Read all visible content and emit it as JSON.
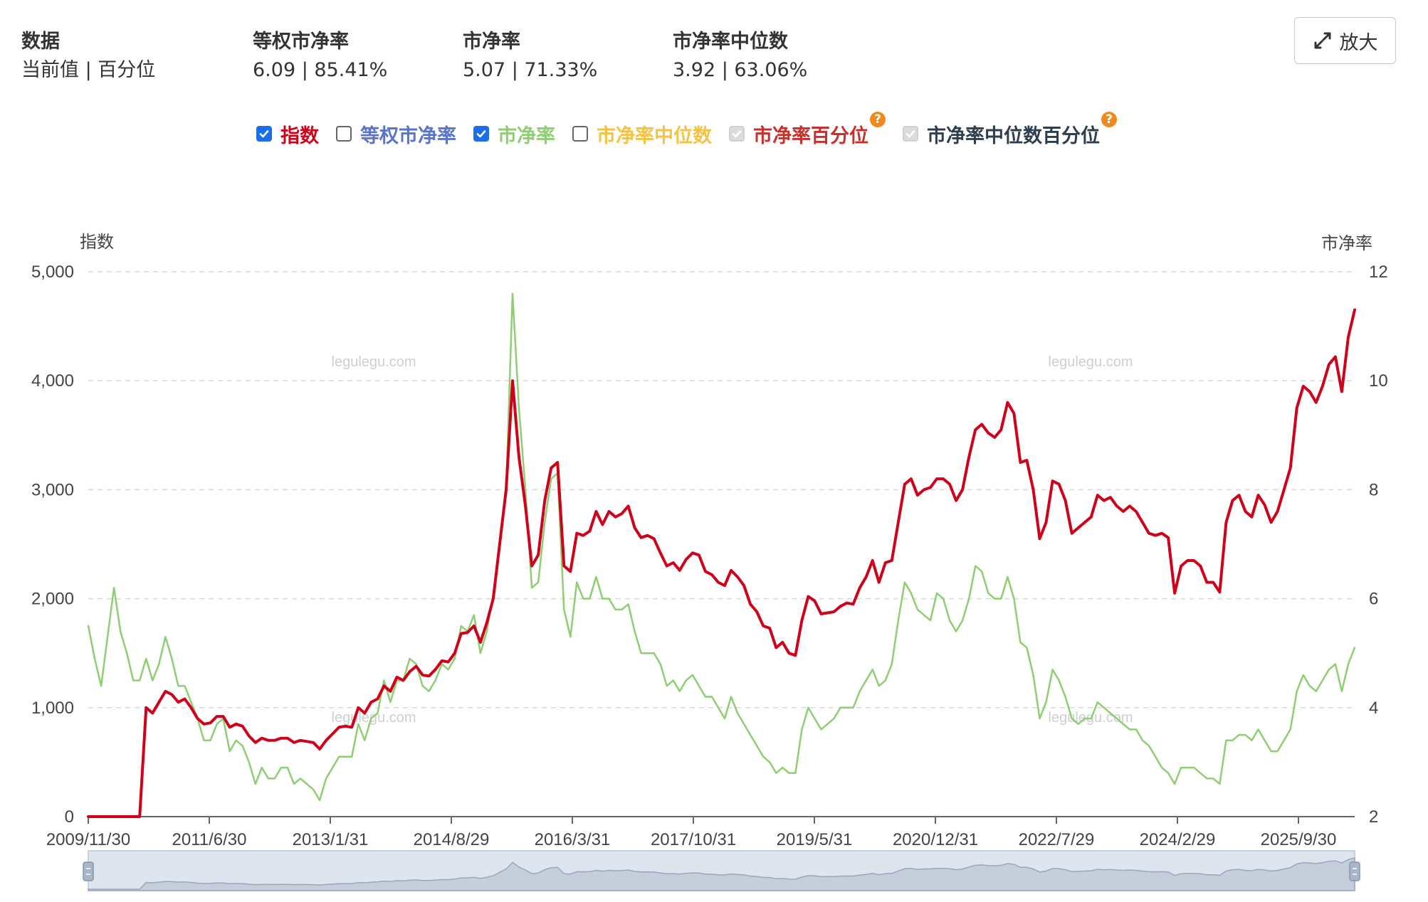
{
  "stats": [
    {
      "label": "数据",
      "value": "当前值 | 百分位"
    },
    {
      "label": "等权市净率",
      "value": "6.09 | 85.41%"
    },
    {
      "label": "市净率",
      "value": "5.07 | 71.33%"
    },
    {
      "label": "市净率中位数",
      "value": "3.92 | 63.06%"
    }
  ],
  "zoom_button": {
    "label": "放大",
    "icon": "expand-arrows-icon"
  },
  "legend": [
    {
      "label": "指数",
      "state": "checked",
      "color": "#d0021b"
    },
    {
      "label": "等权市净率",
      "state": "unchecked",
      "color": "#5b73c8"
    },
    {
      "label": "市净率",
      "state": "checked",
      "color": "#8fce72"
    },
    {
      "label": "市净率中位数",
      "state": "unchecked",
      "color": "#f5c242"
    },
    {
      "label": "市净率百分位",
      "state": "disabled",
      "color": "#c9302c",
      "help": "?"
    },
    {
      "label": "市净率中位数百分位",
      "state": "disabled",
      "color": "#2f3e4e",
      "help": "?"
    }
  ],
  "watermark": "legulegu.com",
  "chart_data": {
    "type": "line",
    "x_ticks": [
      "2009/11/30",
      "2011/6/30",
      "2013/1/31",
      "2014/8/29",
      "2016/3/31",
      "2017/10/31",
      "2019/5/31",
      "2020/12/31",
      "2022/7/29",
      "2024/2/29",
      "2025/9/30"
    ],
    "y_left": {
      "label": "指数",
      "range": [
        0,
        5000
      ],
      "ticks": [
        "0",
        "1,000",
        "2,000",
        "3,000",
        "4,000",
        "5,000"
      ]
    },
    "y_right": {
      "label": "市净率",
      "range": [
        2,
        12
      ],
      "ticks": [
        "2",
        "4",
        "6",
        "8",
        "10",
        "12"
      ]
    },
    "grid": "dashed horizontal",
    "series": [
      {
        "name": "指数",
        "axis": "left",
        "color": "#d0021b",
        "values": [
          0,
          0,
          0,
          0,
          0,
          0,
          0,
          0,
          0,
          1000,
          950,
          1050,
          1150,
          1120,
          1050,
          1080,
          1000,
          900,
          850,
          860,
          920,
          920,
          820,
          850,
          830,
          740,
          680,
          720,
          700,
          700,
          720,
          720,
          680,
          700,
          690,
          680,
          620,
          700,
          760,
          820,
          830,
          820,
          1000,
          950,
          1050,
          1080,
          1200,
          1150,
          1280,
          1250,
          1330,
          1380,
          1300,
          1290,
          1350,
          1430,
          1420,
          1500,
          1680,
          1690,
          1750,
          1600,
          1780,
          2000,
          2500,
          3000,
          4000,
          3300,
          2850,
          2300,
          2400,
          2900,
          3200,
          3250,
          2300,
          2250,
          2600,
          2580,
          2620,
          2800,
          2680,
          2800,
          2750,
          2780,
          2850,
          2650,
          2560,
          2580,
          2550,
          2420,
          2300,
          2330,
          2260,
          2360,
          2420,
          2400,
          2250,
          2220,
          2150,
          2120,
          2260,
          2200,
          2120,
          1950,
          1880,
          1750,
          1730,
          1550,
          1600,
          1500,
          1480,
          1800,
          2020,
          1980,
          1860,
          1870,
          1880,
          1930,
          1960,
          1950,
          2100,
          2200,
          2350,
          2150,
          2330,
          2350,
          2700,
          3050,
          3100,
          2950,
          3000,
          3020,
          3100,
          3100,
          3050,
          2900,
          3000,
          3300,
          3550,
          3600,
          3520,
          3480,
          3550,
          3800,
          3700,
          3250,
          3270,
          3000,
          2550,
          2700,
          3080,
          3050,
          2900,
          2600,
          2650,
          2700,
          2750,
          2950,
          2900,
          2930,
          2850,
          2800,
          2850,
          2800,
          2700,
          2600,
          2580,
          2600,
          2560,
          2050,
          2300,
          2350,
          2350,
          2300,
          2150,
          2150,
          2060,
          2700,
          2900,
          2950,
          2800,
          2750,
          2950,
          2860,
          2700,
          2800,
          3000,
          3200,
          3750,
          3950,
          3900,
          3800,
          3950,
          4150,
          4220,
          3900,
          4400,
          4650
        ]
      },
      {
        "name": "市净率",
        "axis": "right",
        "color": "#8fce72",
        "values": [
          5.5,
          4.9,
          4.4,
          5.3,
          6.2,
          5.4,
          5.0,
          4.5,
          4.5,
          4.9,
          4.5,
          4.8,
          5.3,
          4.9,
          4.4,
          4.4,
          4.1,
          3.8,
          3.4,
          3.4,
          3.7,
          3.8,
          3.2,
          3.4,
          3.3,
          3.0,
          2.6,
          2.9,
          2.7,
          2.7,
          2.9,
          2.9,
          2.6,
          2.7,
          2.6,
          2.5,
          2.3,
          2.7,
          2.9,
          3.1,
          3.1,
          3.1,
          3.7,
          3.4,
          3.8,
          3.9,
          4.5,
          4.1,
          4.5,
          4.5,
          4.9,
          4.8,
          4.4,
          4.3,
          4.5,
          4.8,
          4.7,
          4.9,
          5.5,
          5.4,
          5.7,
          5.0,
          5.4,
          6.1,
          7.0,
          8.0,
          11.6,
          9.5,
          8.0,
          6.2,
          6.3,
          7.4,
          8.2,
          8.3,
          5.8,
          5.3,
          6.3,
          6.0,
          6.0,
          6.4,
          6.0,
          6.0,
          5.8,
          5.8,
          5.9,
          5.4,
          5.0,
          5.0,
          5.0,
          4.8,
          4.4,
          4.5,
          4.3,
          4.5,
          4.6,
          4.4,
          4.2,
          4.2,
          4.0,
          3.8,
          4.2,
          3.9,
          3.7,
          3.5,
          3.3,
          3.1,
          3.0,
          2.8,
          2.9,
          2.8,
          2.8,
          3.6,
          4.0,
          3.8,
          3.6,
          3.7,
          3.8,
          4.0,
          4.0,
          4.0,
          4.3,
          4.5,
          4.7,
          4.4,
          4.5,
          4.8,
          5.6,
          6.3,
          6.1,
          5.8,
          5.7,
          5.6,
          6.1,
          6.0,
          5.6,
          5.4,
          5.6,
          6.0,
          6.6,
          6.5,
          6.1,
          6.0,
          6.0,
          6.4,
          6.0,
          5.2,
          5.1,
          4.6,
          3.8,
          4.1,
          4.7,
          4.5,
          4.2,
          3.8,
          3.7,
          3.8,
          3.8,
          4.1,
          4.0,
          3.9,
          3.8,
          3.7,
          3.6,
          3.6,
          3.4,
          3.3,
          3.1,
          2.9,
          2.8,
          2.6,
          2.9,
          2.9,
          2.9,
          2.8,
          2.7,
          2.7,
          2.6,
          3.4,
          3.4,
          3.5,
          3.5,
          3.4,
          3.6,
          3.4,
          3.2,
          3.2,
          3.4,
          3.6,
          4.3,
          4.6,
          4.4,
          4.3,
          4.5,
          4.7,
          4.8,
          4.3,
          4.8,
          5.1
        ]
      }
    ],
    "navigator": true
  }
}
